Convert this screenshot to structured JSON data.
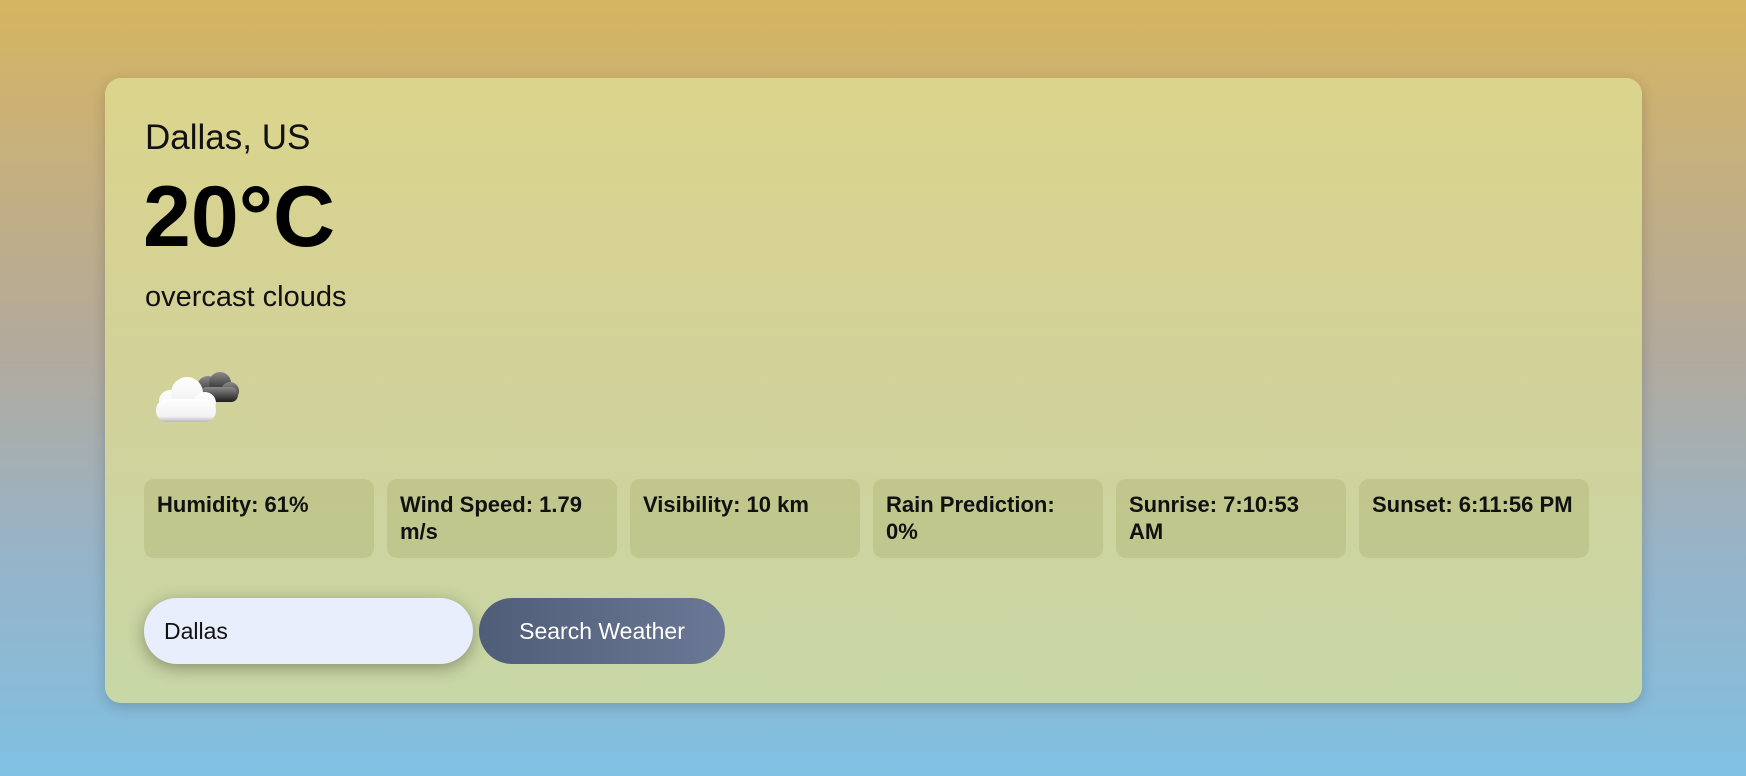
{
  "weather": {
    "location": "Dallas, US",
    "temperature": "20°C",
    "description": "overcast clouds",
    "icon": "overcast-clouds-icon"
  },
  "stats": [
    {
      "label": "Humidity: 61%"
    },
    {
      "label": "Wind Speed: 1.79 m/s"
    },
    {
      "label": "Visibility: 10 km"
    },
    {
      "label": "Rain Prediction: 0%"
    },
    {
      "label": "Sunrise: 7:10:53 AM"
    },
    {
      "label": "Sunset: 6:11:56 PM"
    }
  ],
  "search": {
    "value": "Dallas",
    "button_label": "Search Weather"
  },
  "colors": {
    "button": "#5a6884",
    "input_bg": "#e8eefc"
  }
}
